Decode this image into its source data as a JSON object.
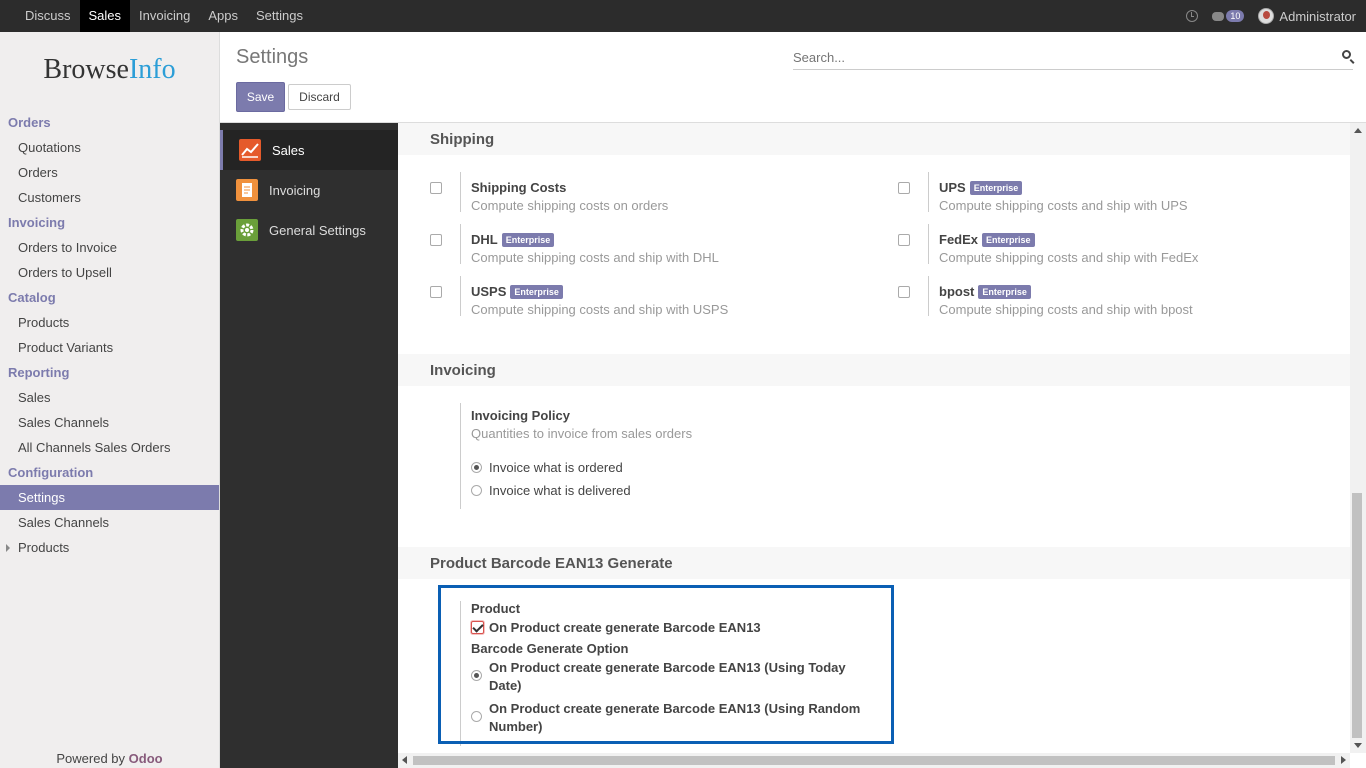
{
  "topbar": {
    "menu": [
      "Discuss",
      "Sales",
      "Invoicing",
      "Apps",
      "Settings"
    ],
    "active_menu": "Sales",
    "message_count": "10",
    "user_name": "Administrator"
  },
  "sidebar": {
    "logo_part1": "Browse",
    "logo_part2": "Info",
    "sections": [
      {
        "title": "Orders",
        "items": [
          "Quotations",
          "Orders",
          "Customers"
        ]
      },
      {
        "title": "Invoicing",
        "items": [
          "Orders to Invoice",
          "Orders to Upsell"
        ]
      },
      {
        "title": "Catalog",
        "items": [
          "Products",
          "Product Variants"
        ]
      },
      {
        "title": "Reporting",
        "items": [
          "Sales",
          "Sales Channels",
          "All Channels Sales Orders"
        ]
      },
      {
        "title": "Configuration",
        "items": [
          "Settings",
          "Sales Channels",
          "Products"
        ]
      }
    ],
    "powered_by": "Powered by",
    "odoo": "Odoo"
  },
  "control": {
    "title": "Settings",
    "search_placeholder": "Search...",
    "save_label": "Save",
    "discard_label": "Discard"
  },
  "apps": [
    {
      "label": "Sales",
      "icon": "sales-chart-icon"
    },
    {
      "label": "Invoicing",
      "icon": "invoice-icon"
    },
    {
      "label": "General Settings",
      "icon": "gear-icon"
    }
  ],
  "shipping": {
    "title": "Shipping",
    "enterprise": "Enterprise",
    "options": [
      {
        "name": "Shipping Costs",
        "desc": "Compute shipping costs on orders",
        "enterprise": false,
        "checked": false
      },
      {
        "name": "UPS",
        "desc": "Compute shipping costs and ship with UPS",
        "enterprise": true,
        "checked": false
      },
      {
        "name": "DHL",
        "desc": "Compute shipping costs and ship with DHL",
        "enterprise": true,
        "checked": false
      },
      {
        "name": "FedEx",
        "desc": "Compute shipping costs and ship with FedEx",
        "enterprise": true,
        "checked": false
      },
      {
        "name": "USPS",
        "desc": "Compute shipping costs and ship with USPS",
        "enterprise": true,
        "checked": false
      },
      {
        "name": "bpost",
        "desc": "Compute shipping costs and ship with bpost",
        "enterprise": true,
        "checked": false
      }
    ]
  },
  "invoicing": {
    "title": "Invoicing",
    "policy_name": "Invoicing Policy",
    "policy_desc": "Quantities to invoice from sales orders",
    "options": [
      "Invoice what is ordered",
      "Invoice what is delivered"
    ],
    "selected": 0
  },
  "barcode": {
    "title": "Product Barcode EAN13 Generate",
    "product_label": "Product",
    "create_label": "On Product create generate Barcode EAN13",
    "create_checked": true,
    "option_label": "Barcode Generate Option",
    "option1_line1": "On Product create generate Barcode EAN13 (Using Today",
    "option1_line2": "Date)",
    "option2_line1": "On Product create generate Barcode EAN13 (Using Random",
    "option2_line2": "Number)",
    "selected": 0
  },
  "colors": {
    "accent": "#7c7bad",
    "highlight_border": "#0a5fb4",
    "topbar": "#2c2c2c"
  }
}
